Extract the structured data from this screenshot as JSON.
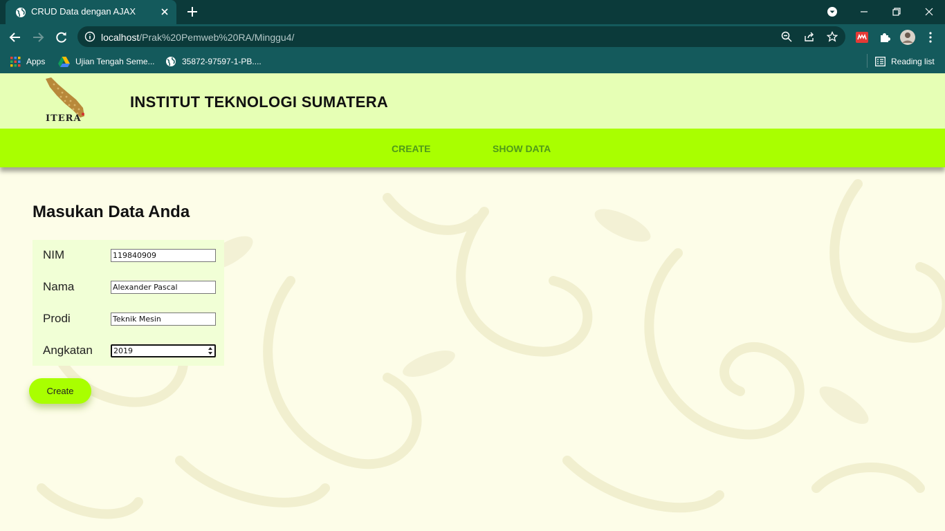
{
  "browser": {
    "tab_title": "CRUD Data dengan AJAX",
    "url_host": "localhost",
    "url_path": "/Prak%20Pemweb%20RA/Minggu4/",
    "bookmarks": [
      {
        "label": "Apps",
        "icon": "apps-grid-icon"
      },
      {
        "label": "Ujian Tengah Seme...",
        "icon": "google-drive-icon"
      },
      {
        "label": "35872-97597-1-PB....",
        "icon": "globe-icon"
      }
    ],
    "reading_list_label": "Reading list"
  },
  "header": {
    "logo_text": "ITERA",
    "title": "INSTITUT TEKNOLOGI SUMATERA"
  },
  "nav": {
    "create_label": "CREATE",
    "show_data_label": "SHOW DATA"
  },
  "form": {
    "heading": "Masukan Data Anda",
    "fields": [
      {
        "label": "NIM",
        "value": "119840909"
      },
      {
        "label": "Nama",
        "value": "Alexander Pascal"
      },
      {
        "label": "Prodi",
        "value": "Teknik Mesin"
      },
      {
        "label": "Angkatan",
        "value": "2019"
      }
    ],
    "submit_label": "Create"
  },
  "colors": {
    "header_bg": "#e6ffb5",
    "nav_bg": "#a9ff00",
    "nav_link": "#4f9a1a",
    "page_bg": "#fdfde8",
    "chrome_dark": "#0b3a3a",
    "chrome": "#145a5c"
  }
}
